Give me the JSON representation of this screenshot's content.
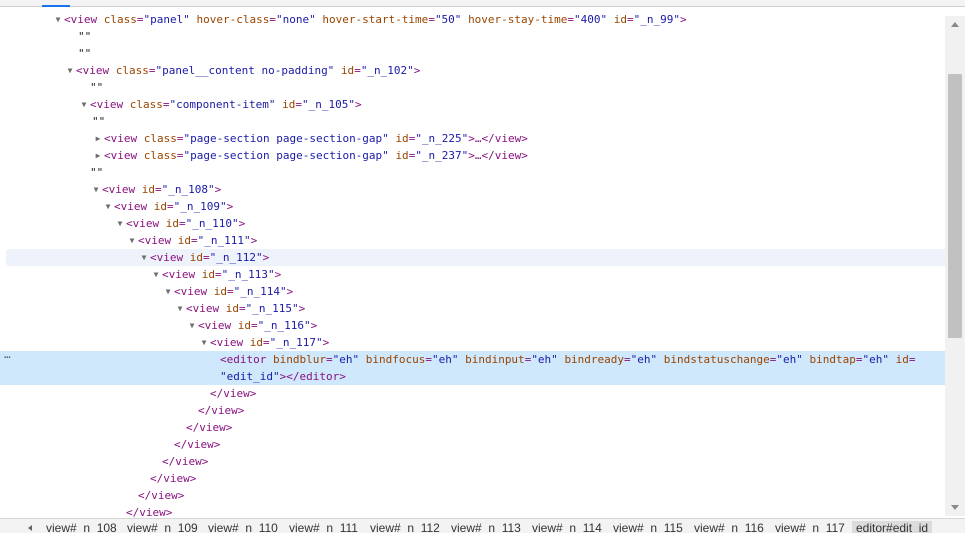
{
  "tree": {
    "lines": [
      {
        "arrow": "expanded",
        "open": "<view",
        "attrs": [
          {
            "n": "class",
            "v": "panel"
          },
          {
            "n": "hover-class",
            "v": "none"
          },
          {
            "n": "hover-start-time",
            "v": "50"
          },
          {
            "n": "hover-stay-time",
            "v": "400"
          },
          {
            "n": "id",
            "v": "_n_99"
          }
        ],
        "close": ">"
      },
      {
        "text": "\"\""
      },
      {
        "text": "\"\""
      },
      {
        "arrow": "expanded",
        "open": "<view",
        "attrs": [
          {
            "n": "class",
            "v": "panel__content no-padding"
          },
          {
            "n": "id",
            "v": "_n_102"
          }
        ],
        "close": ">"
      },
      {
        "text": "\"\""
      },
      {
        "arrow": "expanded",
        "open": "<view",
        "attrs": [
          {
            "n": "class",
            "v": "component-item"
          },
          {
            "n": "id",
            "v": "_n_105"
          }
        ],
        "close": ">"
      },
      {
        "text": "\"\""
      },
      {
        "arrow": "collapsed",
        "open": "<view",
        "attrs": [
          {
            "n": "class",
            "v": "page-section page-section-gap"
          },
          {
            "n": "id",
            "v": "_n_225"
          }
        ],
        "close": ">…</view>"
      },
      {
        "arrow": "collapsed",
        "open": "<view",
        "attrs": [
          {
            "n": "class",
            "v": "page-section page-section-gap"
          },
          {
            "n": "id",
            "v": "_n_237"
          }
        ],
        "close": ">…</view>"
      },
      {
        "text": "\"\""
      },
      {
        "arrow": "expanded",
        "open": "<view",
        "attrs": [
          {
            "n": "id",
            "v": "_n_108"
          }
        ],
        "close": ">"
      },
      {
        "arrow": "expanded",
        "open": "<view",
        "attrs": [
          {
            "n": "id",
            "v": "_n_109"
          }
        ],
        "close": ">"
      },
      {
        "arrow": "expanded",
        "open": "<view",
        "attrs": [
          {
            "n": "id",
            "v": "_n_110"
          }
        ],
        "close": ">"
      },
      {
        "arrow": "expanded",
        "open": "<view",
        "attrs": [
          {
            "n": "id",
            "v": "_n_111"
          }
        ],
        "close": ">"
      },
      {
        "arrow": "expanded",
        "open": "<view",
        "attrs": [
          {
            "n": "id",
            "v": "_n_112"
          }
        ],
        "close": ">"
      },
      {
        "arrow": "expanded",
        "open": "<view",
        "attrs": [
          {
            "n": "id",
            "v": "_n_113"
          }
        ],
        "close": ">"
      },
      {
        "arrow": "expanded",
        "open": "<view",
        "attrs": [
          {
            "n": "id",
            "v": "_n_114"
          }
        ],
        "close": ">"
      },
      {
        "arrow": "expanded",
        "open": "<view",
        "attrs": [
          {
            "n": "id",
            "v": "_n_115"
          }
        ],
        "close": ">"
      },
      {
        "arrow": "expanded",
        "open": "<view",
        "attrs": [
          {
            "n": "id",
            "v": "_n_116"
          }
        ],
        "close": ">"
      },
      {
        "arrow": "expanded",
        "open": "<view",
        "attrs": [
          {
            "n": "id",
            "v": "_n_117"
          }
        ],
        "close": ">"
      },
      {
        "open": "<editor",
        "attrs": [
          {
            "n": "bindblur",
            "v": "eh"
          },
          {
            "n": "bindfocus",
            "v": "eh"
          },
          {
            "n": "bindinput",
            "v": "eh"
          },
          {
            "n": "bindready",
            "v": "eh"
          },
          {
            "n": "bindstatuschange",
            "v": "eh"
          },
          {
            "n": "bindtap",
            "v": "eh"
          },
          {
            "n": "id",
            "v": ""
          }
        ],
        "close": ""
      },
      {
        "continuation": "\"edit_id\">",
        "closeTag": "</editor>"
      },
      {
        "close": "</view>"
      },
      {
        "close": "</view>"
      },
      {
        "close": "</view>"
      },
      {
        "close": "</view>"
      },
      {
        "close": "</view>"
      },
      {
        "close": "</view>"
      },
      {
        "close": "</view>"
      },
      {
        "close": "</view>"
      }
    ],
    "more_menu": "…"
  },
  "breadcrumbs": [
    "view#_n_108",
    "view#_n_109",
    "view#_n_110",
    "view#_n_111",
    "view#_n_112",
    "view#_n_113",
    "view#_n_114",
    "view#_n_115",
    "view#_n_116",
    "view#_n_117",
    "editor#edit_id"
  ],
  "colors": {
    "tag": "#881280",
    "attr_name": "#994500",
    "attr_value": "#1a1aa6",
    "hover_row": "#eef3fb",
    "selected_row": "#cfe8fc"
  },
  "icons": {
    "expanded": "triangle-down-icon",
    "collapsed": "triangle-right-icon",
    "more": "ellipsis-icon"
  }
}
